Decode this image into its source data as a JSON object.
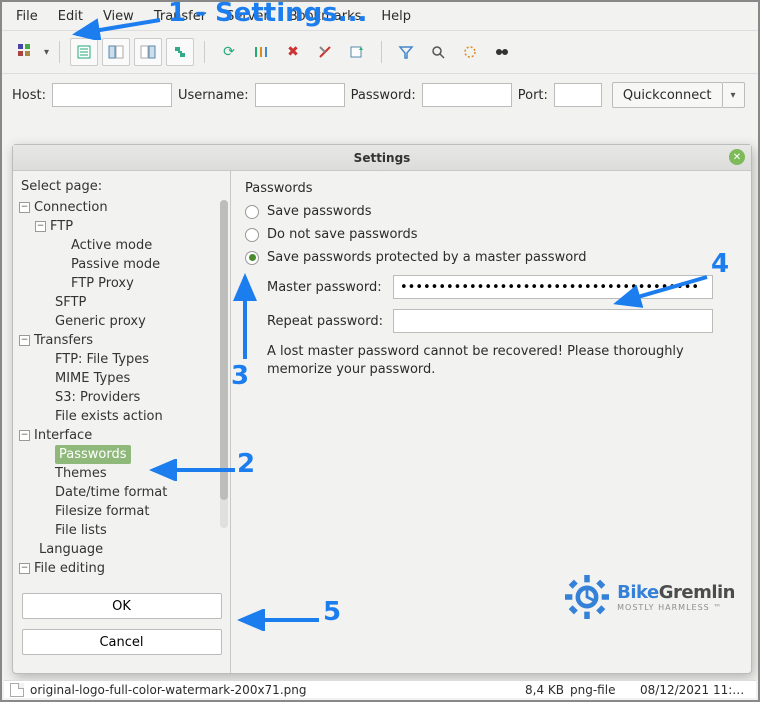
{
  "menubar": {
    "file": "File",
    "edit": "Edit",
    "view": "View",
    "transfer": "Transfer",
    "server": "Server",
    "bookmarks": "Bookmarks",
    "help": "Help"
  },
  "connbar": {
    "host_label": "Host:",
    "username_label": "Username:",
    "password_label": "Password:",
    "port_label": "Port:",
    "quickconnect": "Quickconnect"
  },
  "dialog": {
    "title": "Settings",
    "sidebar_label": "Select page:",
    "tree": {
      "connection": "Connection",
      "ftp": "FTP",
      "active_mode": "Active mode",
      "passive_mode": "Passive mode",
      "ftp_proxy": "FTP Proxy",
      "sftp": "SFTP",
      "generic_proxy": "Generic proxy",
      "transfers": "Transfers",
      "ftp_file_types": "FTP: File Types",
      "mime_types": "MIME Types",
      "s3_providers": "S3: Providers",
      "file_exists": "File exists action",
      "interface": "Interface",
      "passwords": "Passwords",
      "themes": "Themes",
      "datetime": "Date/time format",
      "filesize": "Filesize format",
      "filelists": "File lists",
      "language": "Language",
      "file_editing": "File editing"
    },
    "ok": "OK",
    "cancel": "Cancel",
    "panel": {
      "heading": "Passwords",
      "opt_save": "Save passwords",
      "opt_nosave": "Do not save passwords",
      "opt_master": "Save passwords protected by a master password",
      "master_label": "Master password:",
      "repeat_label": "Repeat password:",
      "master_value": "•••••••••••••••••••••••••••••••••••••••",
      "repeat_value": "",
      "warning": "A lost master password cannot be recovered! Please thoroughly memorize your password."
    }
  },
  "annotations": {
    "a1": "1  -  Settings...",
    "a2": "2",
    "a3": "3",
    "a4": "4",
    "a5": "5"
  },
  "watermark": {
    "name_a": "Bike",
    "name_b": "Gremlin",
    "tagline": "MOSTLY HARMLESS ™"
  },
  "filerow": {
    "name": "original-logo-full-color-watermark-200x71.png",
    "size": "8,4 KB",
    "type": "png-file",
    "date": "08/12/2021 11:…"
  }
}
